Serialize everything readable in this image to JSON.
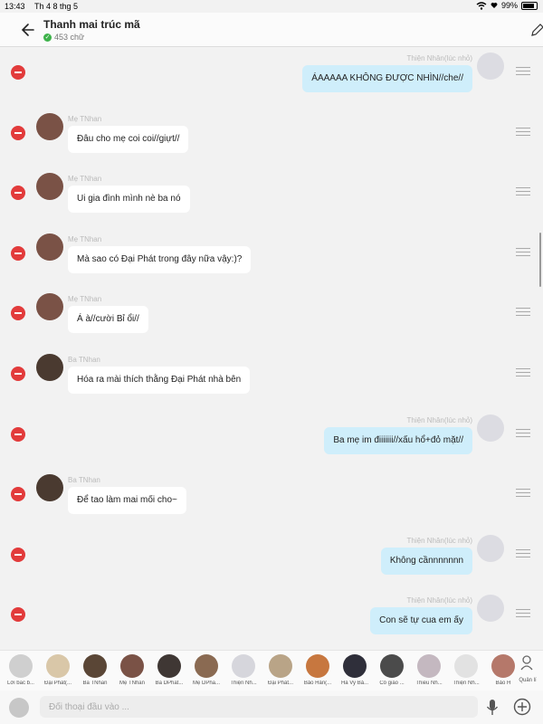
{
  "status_bar": {
    "time": "13:43",
    "date": "Th 4 8 thg 5",
    "battery": "99%"
  },
  "header": {
    "title": "Thanh mai trúc mã",
    "word_count": "453 chữ"
  },
  "messages": [
    {
      "side": "right",
      "sender": "Thiện Nhân(lúc nhỏ)",
      "text": "ÁAAAAA KHÔNG ĐƯỢC NHÌN//che//"
    },
    {
      "side": "left",
      "sender": "Mẹ TNhan",
      "text": "Đâu cho mẹ coi coi//giựt//"
    },
    {
      "side": "left",
      "sender": "Mẹ TNhan",
      "text": "Ui gia đình mình nè ba nó"
    },
    {
      "side": "left",
      "sender": "Mẹ TNhan",
      "text": "Mà sao có Đại Phát trong đây nữa vậy:)?"
    },
    {
      "side": "left",
      "sender": "Mẹ TNhan",
      "text": "Á à//cười Bỉ ổi//"
    },
    {
      "side": "left",
      "sender": "Ba TNhan",
      "text": "Hóa ra mài thích thằng Đại Phát nhà bên"
    },
    {
      "side": "right",
      "sender": "Thiện Nhân(lúc nhỏ)",
      "text": "Ba mẹ im điiiiiii//xấu hổ+đỏ mặt//"
    },
    {
      "side": "left",
      "sender": "Ba TNhan",
      "text": "Để tao làm mai mối cho~"
    },
    {
      "side": "right",
      "sender": "Thiện Nhân(lúc nhỏ)",
      "text": "Không cầnnnnnnn"
    },
    {
      "side": "right",
      "sender": "Thiện Nhân(lúc nhỏ)",
      "text": "Con sẽ tự cua em ấy"
    }
  ],
  "characters": [
    {
      "label": "Lời bắc b...",
      "color": "#cfcfcf"
    },
    {
      "label": "Đại Phát(...",
      "color": "#d9c7a8"
    },
    {
      "label": "Ba TNhan",
      "color": "#5a4636"
    },
    {
      "label": "Mẹ TNhan",
      "color": "#7a5246"
    },
    {
      "label": "Ba DPhat...",
      "color": "#3f3734"
    },
    {
      "label": "Mẹ DPha...",
      "color": "#8a6a52"
    },
    {
      "label": "Thiện Nh...",
      "color": "#d6d6dc"
    },
    {
      "label": "Đại Phát...",
      "color": "#b9a487"
    },
    {
      "label": "Bảo Hân(...",
      "color": "#c7773f"
    },
    {
      "label": "Hà Vy Bả...",
      "color": "#2f2f3a"
    },
    {
      "label": "Cô giáo ...",
      "color": "#4b4b4b"
    },
    {
      "label": "Thiều Nh...",
      "color": "#c4b8c0"
    },
    {
      "label": "Thiện Nh...",
      "color": "#e2e2e2"
    },
    {
      "label": "Bảo H",
      "color": "#b5786a"
    }
  ],
  "manage_label": "Quản lí",
  "input": {
    "placeholder": "Đối thoại đầu vào ..."
  }
}
